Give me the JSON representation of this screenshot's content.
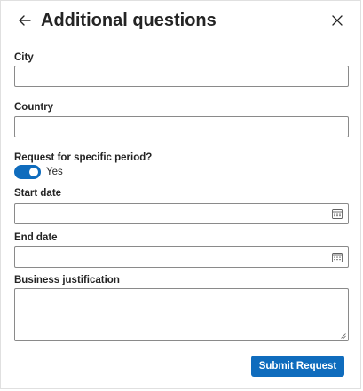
{
  "header": {
    "title": "Additional questions"
  },
  "fields": {
    "city": {
      "label": "City",
      "value": ""
    },
    "country": {
      "label": "Country",
      "value": ""
    },
    "period": {
      "label": "Request for specific period?",
      "toggle_text": "Yes",
      "enabled": true
    },
    "start_date": {
      "label": "Start date",
      "value": ""
    },
    "end_date": {
      "label": "End date",
      "value": ""
    },
    "justification": {
      "label": "Business justification",
      "value": ""
    }
  },
  "actions": {
    "submit_label": "Submit Request"
  },
  "colors": {
    "accent": "#0f6cbd",
    "border": "#8a8a8a",
    "text": "#242424"
  },
  "icons": {
    "back": "arrow-left-icon",
    "close": "close-icon",
    "calendar": "calendar-icon"
  }
}
